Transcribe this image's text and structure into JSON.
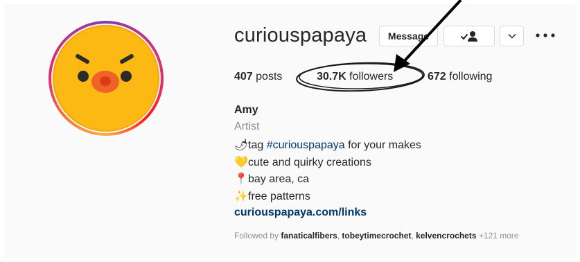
{
  "profile": {
    "username": "curiouspapaya",
    "buttons": {
      "message": "Message",
      "dropdown_icon": "chevron-down-icon",
      "follow_icon": "person-check-icon",
      "more_icon": "more-horizontal-icon"
    },
    "stats": {
      "posts_count": "407",
      "posts_label": "posts",
      "followers_count": "30.7K",
      "followers_label": "followers",
      "following_count": "672",
      "following_label": "following"
    },
    "bio": {
      "name": "Amy",
      "category": "Artist",
      "lines": [
        {
          "emoji": "🌶",
          "text_before": "tag ",
          "hashtag": "#curiouspapaya",
          "text_after": " for your makes"
        },
        {
          "emoji": "💛",
          "text": "cute and quirky creations"
        },
        {
          "emoji": "📍",
          "text": "bay area, ca"
        },
        {
          "emoji": "✨",
          "text": "free patterns"
        }
      ],
      "link": "curiouspapaya.com/links"
    },
    "followed_by": {
      "prefix": "Followed by ",
      "users": [
        "fanaticalfibers",
        "tobeytimecrochet",
        "kelvencrochets"
      ],
      "suffix": "+121 more"
    }
  },
  "colors": {
    "link": "#00376b",
    "secondary_text": "#8e8e8e",
    "avatar_fill": "#fcb813"
  }
}
